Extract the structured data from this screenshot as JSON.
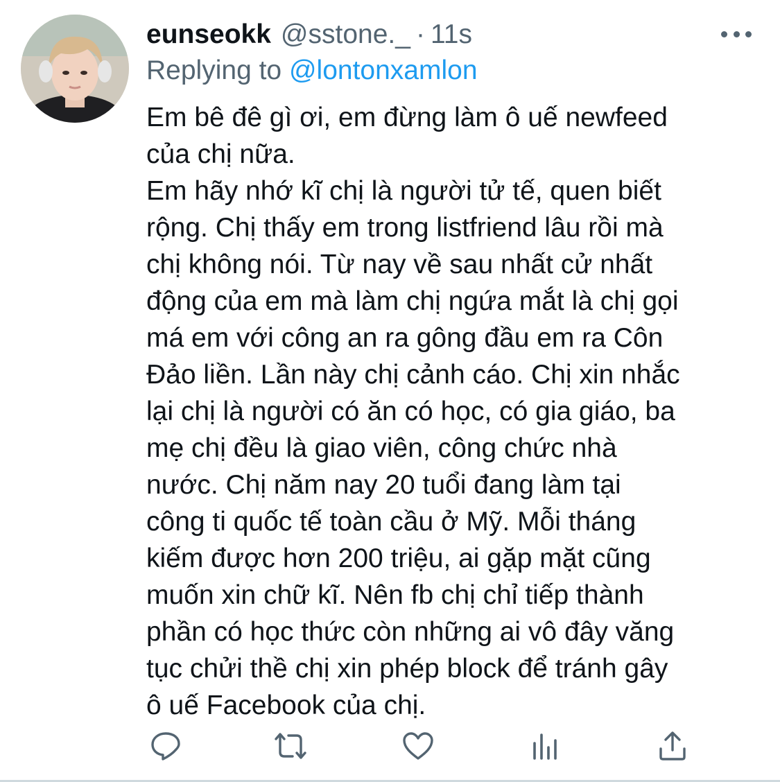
{
  "tweet": {
    "display_name": "eunseokk",
    "handle": "@sstone._",
    "separator": "·",
    "timestamp": "11s",
    "replying_prefix": "Replying to ",
    "replying_to": "@lontonxamlon",
    "text_lines": [
      "Em bê đê gì ơi, em đừng làm ô uế newfeed",
      "của chị nữa.",
      "Em hãy nhớ kĩ chị là người tử tế, quen biết",
      "rộng. Chị thấy em trong listfriend lâu rồi mà",
      "chị không nói. Từ nay về sau nhất cử nhất",
      "động của em mà làm chị ngứa mắt là chị gọi",
      "má em với công an ra gông đầu em ra Côn",
      "Đảo liền. Lần này chị cảnh cáo. Chị xin nhắc",
      "lại chị là người có ăn có học, có gia giáo, ba",
      "mẹ chị đều là giao viên, công chức nhà",
      "nước. Chị năm nay 20 tuổi đang làm tại",
      "công ti quốc tế toàn cầu ở Mỹ. Mỗi tháng",
      "kiếm được hơn 200 triệu, ai gặp mặt cũng",
      "muốn xin chữ kĩ. Nên fb chị chỉ tiếp thành",
      "phần có học thức còn những ai vô đây văng",
      "tục chửi thề chị xin phép block để tránh gây",
      "ô uế Facebook của chị."
    ]
  },
  "icons": {
    "more": "more-horizontal-icon",
    "reply": "reply-bubble-icon",
    "retweet": "retweet-icon",
    "like": "heart-icon",
    "analytics": "analytics-bars-icon",
    "share": "share-upload-icon"
  },
  "colors": {
    "text_primary": "#0f1419",
    "text_secondary": "#536471",
    "accent": "#1d9bf0",
    "divider": "#cfd9de"
  }
}
